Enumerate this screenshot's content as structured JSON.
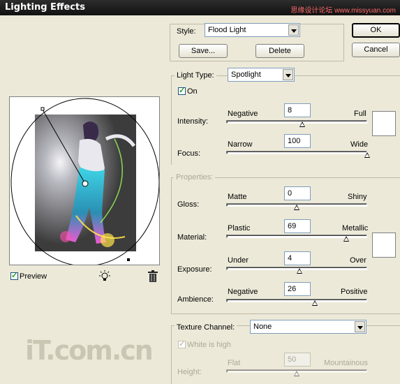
{
  "window": {
    "title": "Lighting Effects",
    "watermark": "思缘设计论坛 www.missyuan.com"
  },
  "buttons": {
    "ok": "OK",
    "cancel": "Cancel",
    "save": "Save...",
    "delete": "Delete"
  },
  "style": {
    "label": "Style:",
    "value": "Flood Light"
  },
  "light_type": {
    "label": "Light Type:",
    "value": "Spotlight",
    "on_label": "On",
    "on_checked": true
  },
  "intensity": {
    "label": "Intensity:",
    "min": "Negative",
    "max": "Full",
    "value": "8",
    "position": 0.54
  },
  "focus": {
    "label": "Focus:",
    "min": "Narrow",
    "max": "Wide",
    "value": "100",
    "position": 1.0
  },
  "properties": {
    "legend": "Properties:"
  },
  "gloss": {
    "label": "Gloss:",
    "min": "Matte",
    "max": "Shiny",
    "value": "0",
    "position": 0.5
  },
  "material": {
    "label": "Material:",
    "min": "Plastic",
    "max": "Metallic",
    "value": "69",
    "position": 0.85
  },
  "exposure": {
    "label": "Exposure:",
    "min": "Under",
    "max": "Over",
    "value": "4",
    "position": 0.52
  },
  "ambience": {
    "label": "Ambience:",
    "min": "Negative",
    "max": "Positive",
    "value": "26",
    "position": 0.63
  },
  "texture": {
    "label": "Texture Channel:",
    "value": "None",
    "white_high_label": "White is high",
    "white_high_checked": true
  },
  "height": {
    "label": "Height:",
    "min": "Flat",
    "max": "Mountainous",
    "value": "50",
    "position": 0.5
  },
  "preview": {
    "label": "Preview",
    "checked": true
  },
  "icons": {
    "light": "lightbulb-icon",
    "trash": "trash-icon"
  },
  "colors": {
    "titlebar": "#1a1a1a",
    "dialog": "#ece9d8",
    "preview_bg": "#5c5c5c"
  },
  "brand": "iT.com.cn"
}
